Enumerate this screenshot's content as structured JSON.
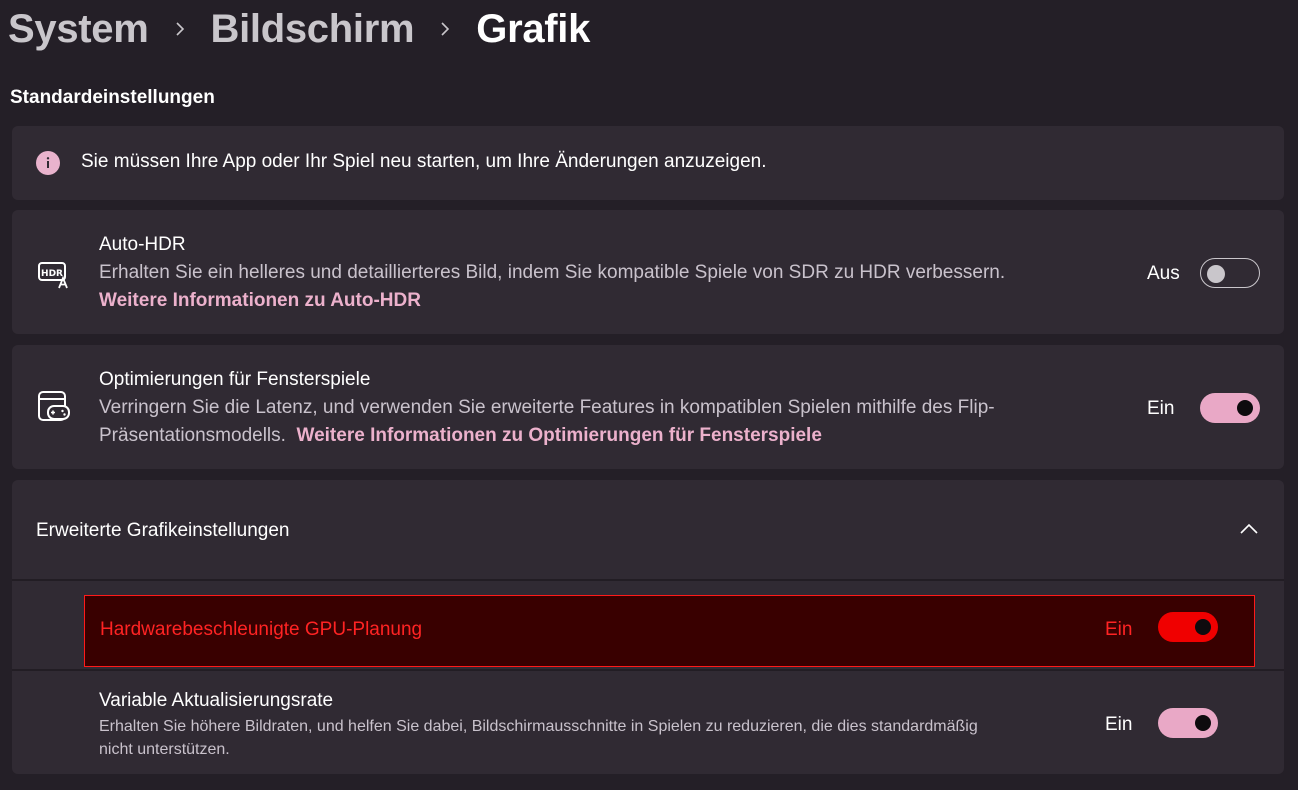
{
  "breadcrumb": {
    "items": [
      "System",
      "Bildschirm",
      "Grafik"
    ]
  },
  "section_title": "Standardeinstellungen",
  "info": {
    "icon": "info-icon",
    "text": "Sie müssen Ihre App oder Ihr Spiel neu starten, um Ihre Änderungen anzuzeigen."
  },
  "auto_hdr": {
    "icon": "hdr-icon",
    "title": "Auto-HDR",
    "description": "Erhalten Sie ein helleres und detaillierteres Bild, indem Sie kompatible Spiele von SDR zu HDR verbessern.",
    "link": "Weitere Informationen zu Auto-HDR",
    "state_label": "Aus",
    "enabled": false
  },
  "windowed_games": {
    "icon": "game-window-icon",
    "title": "Optimierungen für Fensterspiele",
    "description": "Verringern Sie die Latenz, und verwenden Sie erweiterte Features in kompatiblen Spielen mithilfe des Flip-Präsentationsmodells.",
    "link": "Weitere Informationen zu Optimierungen für Fensterspiele",
    "state_label": "Ein",
    "enabled": true
  },
  "advanced": {
    "title": "Erweiterte Grafikeinstellungen",
    "expanded": true,
    "gpu_scheduling": {
      "title": "Hardwarebeschleunigte GPU-Planung",
      "state_label": "Ein",
      "enabled": true,
      "highlight_color": "#ff0000"
    },
    "variable_refresh": {
      "title": "Variable Aktualisierungsrate",
      "description": "Erhalten Sie höhere Bildraten, und helfen Sie dabei, Bildschirmausschnitte in Spielen zu reduzieren, die dies standardmäßig nicht unterstützen.",
      "state_label": "Ein",
      "enabled": true
    }
  },
  "colors": {
    "accent": "#e9a8c6",
    "link": "#ecb1cc",
    "background": "#241f27",
    "card": "#302a33"
  }
}
